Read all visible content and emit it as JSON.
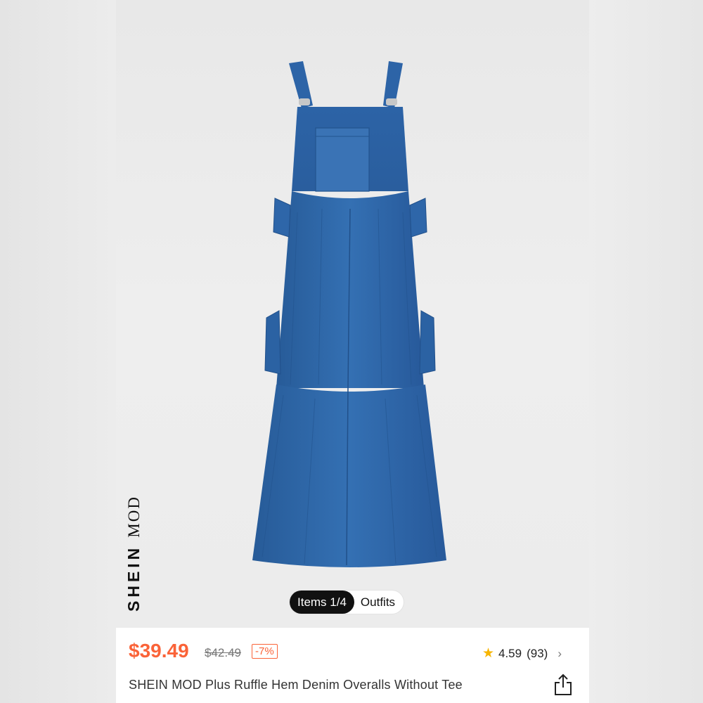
{
  "gallery": {
    "brand_logo": {
      "part1": "SHEIN",
      "part2": "MOD"
    },
    "toggle": {
      "items_label": "Items 1/4",
      "outfits_label": "Outfits"
    }
  },
  "product": {
    "price": "$39.49",
    "original_price": "$42.49",
    "discount": "-7%",
    "rating": "4.59",
    "review_count": "(93)",
    "title": "SHEIN MOD Plus Ruffle Hem Denim Overalls Without Tee"
  },
  "icons": {
    "rating_star": "star-icon",
    "rating_chevron": "chevron-right-icon",
    "share": "share-icon"
  },
  "colors": {
    "price": "#fa6338",
    "star": "#f7b500",
    "toggle_active_bg": "#111111",
    "denim": "#2f67a8"
  }
}
